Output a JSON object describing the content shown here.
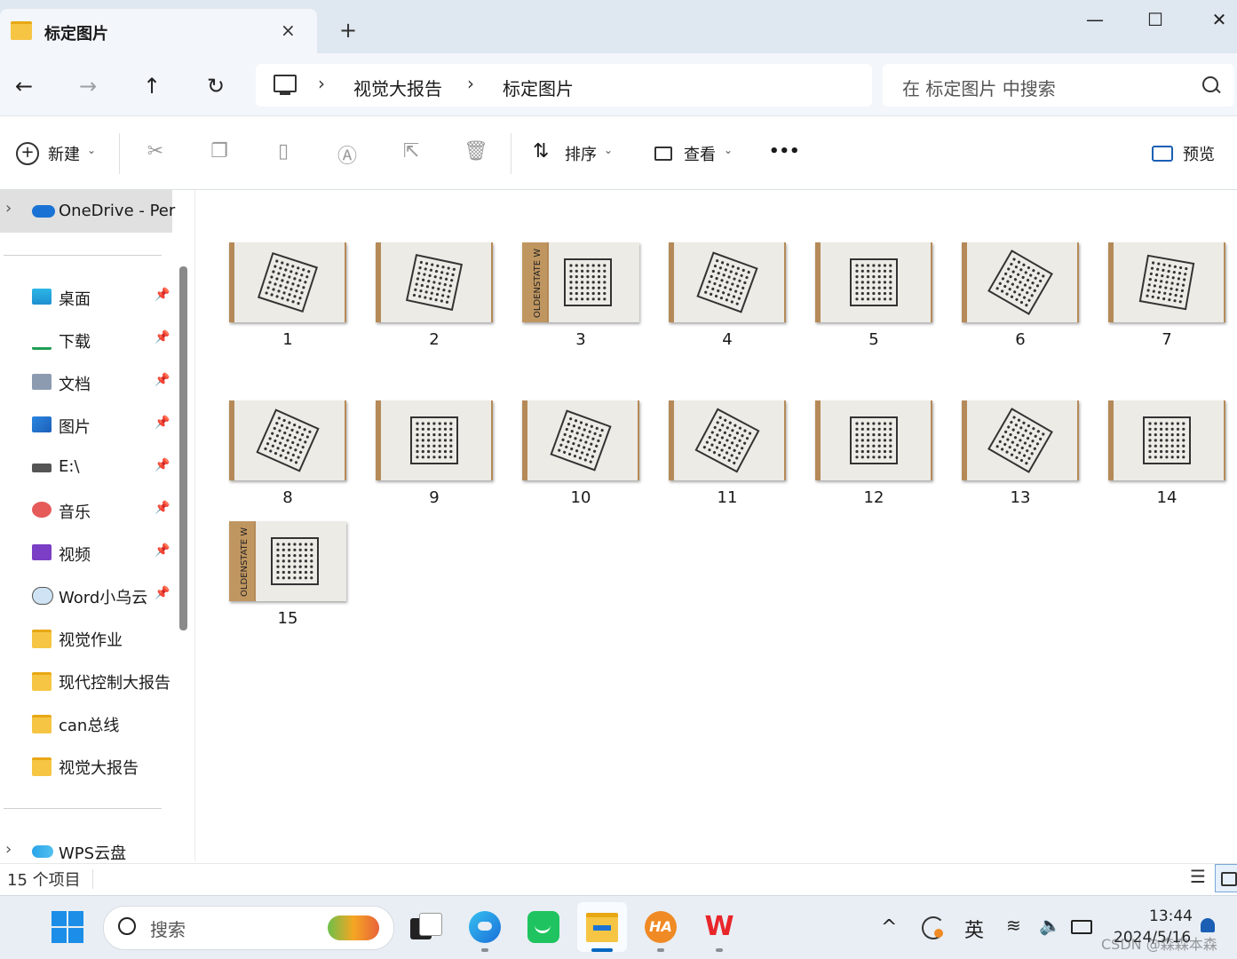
{
  "window": {
    "tab_title": "标定图片",
    "tab_close": "×",
    "new_tab": "+",
    "minimize": "—",
    "maximize": "☐",
    "close": "✕"
  },
  "nav": {
    "back": "←",
    "forward": "→",
    "up": "↑",
    "refresh": "↻",
    "breadcrumb": [
      "视觉大报告",
      "标定图片"
    ],
    "sep": "›",
    "search_placeholder": "在 标定图片 中搜索"
  },
  "commands": {
    "new_label": "新建",
    "sort_label": "排序",
    "view_label": "查看",
    "more": "•••",
    "preview_label": "预览",
    "dropdown": "⌄"
  },
  "sidebar": {
    "onedrive": "OneDrive - Per",
    "items": [
      {
        "label": "桌面",
        "icon": "desktop-icon",
        "pinned": true
      },
      {
        "label": "下载",
        "icon": "download-icon",
        "pinned": true
      },
      {
        "label": "文档",
        "icon": "document-icon",
        "pinned": true
      },
      {
        "label": "图片",
        "icon": "pictures-icon",
        "pinned": true
      },
      {
        "label": "E:\\",
        "icon": "drive-icon",
        "pinned": true
      },
      {
        "label": "音乐",
        "icon": "music-icon",
        "pinned": true
      },
      {
        "label": "视频",
        "icon": "video-icon",
        "pinned": true
      },
      {
        "label": "Word小乌云",
        "icon": "cloud-icon",
        "pinned": true
      },
      {
        "label": "视觉作业",
        "icon": "folder-icon",
        "pinned": false
      },
      {
        "label": "现代控制大报告",
        "icon": "folder-icon",
        "pinned": false
      },
      {
        "label": "can总线",
        "icon": "folder-icon",
        "pinned": false
      },
      {
        "label": "视觉大报告",
        "icon": "folder-icon",
        "pinned": false
      }
    ],
    "wps": "WPS云盘",
    "pin_glyph": "📌",
    "expand": "›"
  },
  "files": [
    "1",
    "2",
    "3",
    "4",
    "5",
    "6",
    "7",
    "8",
    "9",
    "10",
    "11",
    "12",
    "13",
    "14",
    "15"
  ],
  "status": {
    "count": "15 个项目"
  },
  "taskbar": {
    "search_placeholder": "搜索",
    "ime": "英",
    "time": "13:44",
    "date": "2024/5/16",
    "watermark": "CSDN @森森本森",
    "chevron": "^"
  },
  "colors": {
    "accent": "#0067c0",
    "folder": "#f6c544",
    "thumb_bg": "#e9e6e0",
    "cardboard": "#b58a58"
  }
}
